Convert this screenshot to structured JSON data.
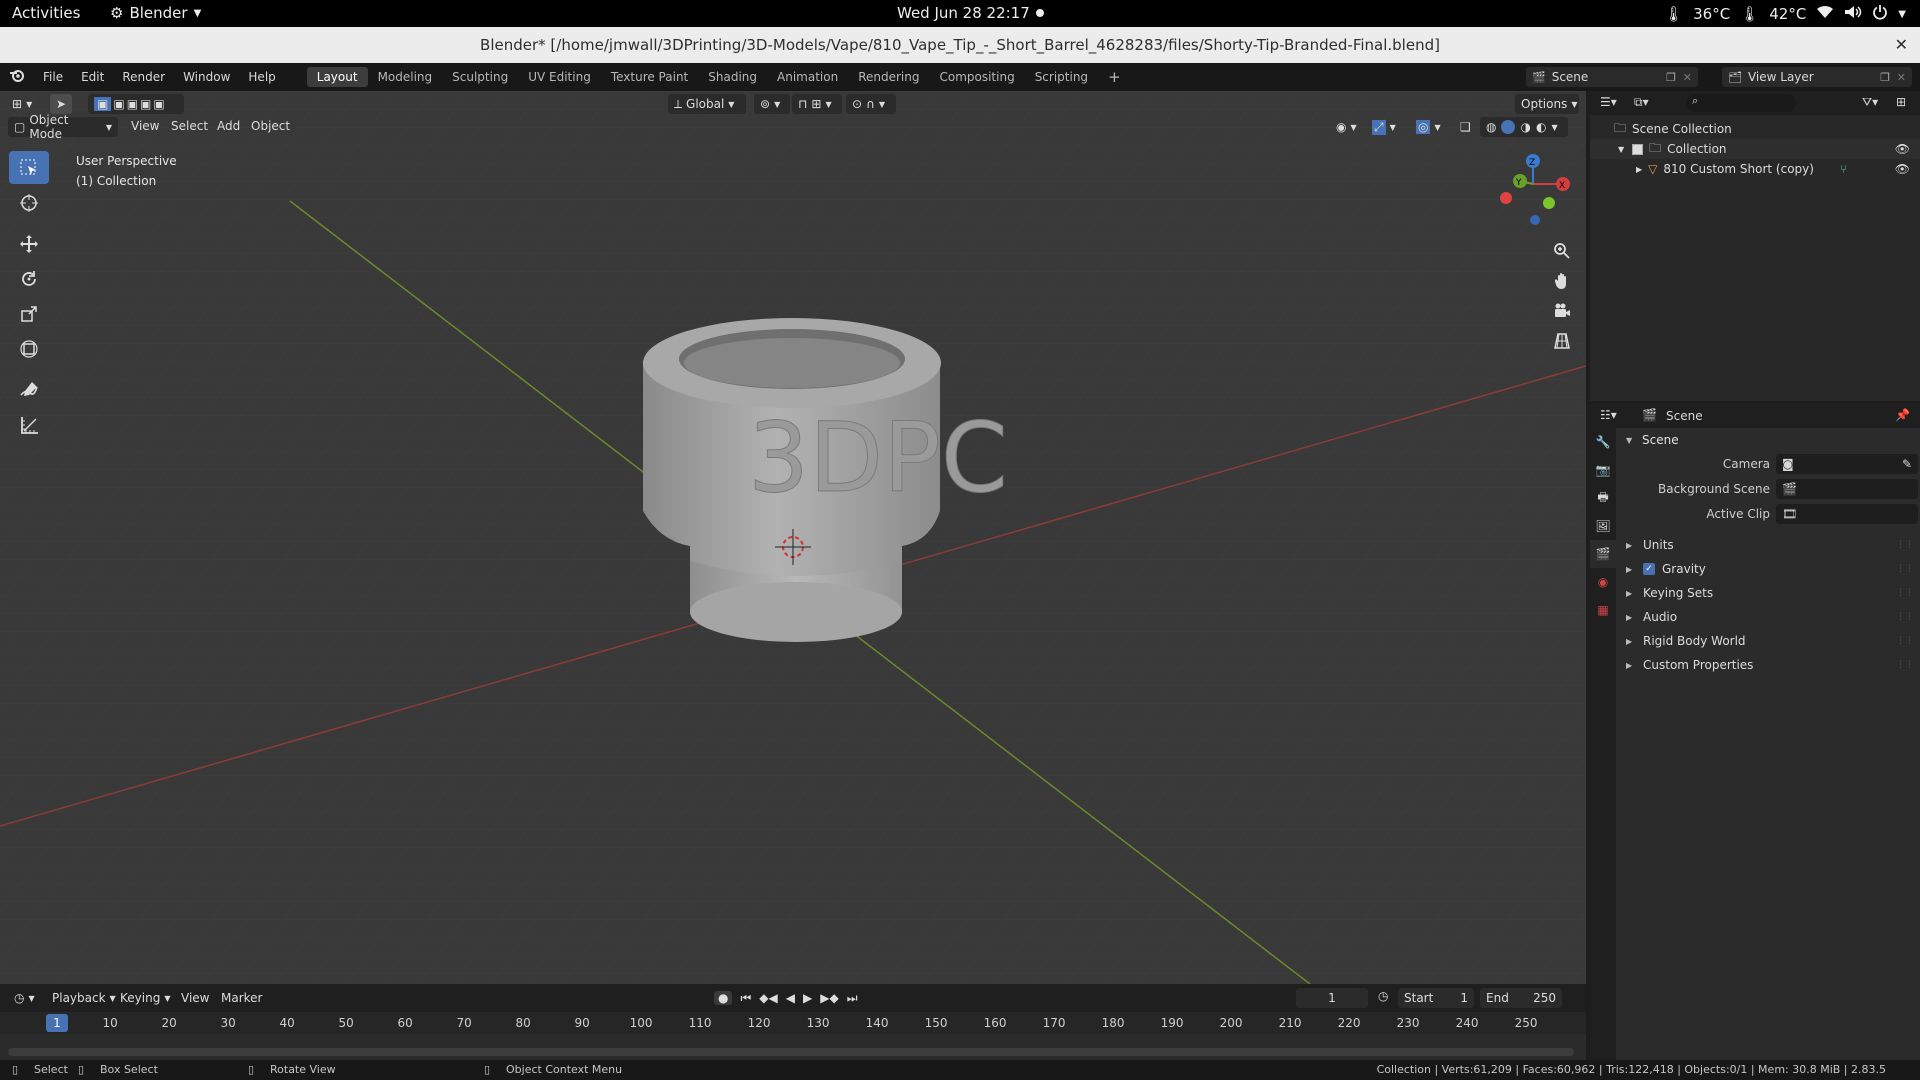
{
  "gnome": {
    "activities": "Activities",
    "app": "Blender",
    "clock": "Wed Jun 28  22:17",
    "temp1": "36°C",
    "temp2": "42°C"
  },
  "window": {
    "title": "Blender* [/home/jmwall/3DPrinting/3D-Models/Vape/810_Vape_Tip_-_Short_Barrel_4628283/files/Shorty-Tip-Branded-Final.blend]"
  },
  "menu": [
    "File",
    "Edit",
    "Render",
    "Window",
    "Help"
  ],
  "workspaces": [
    "Layout",
    "Modeling",
    "Sculpting",
    "UV Editing",
    "Texture Paint",
    "Shading",
    "Animation",
    "Rendering",
    "Compositing",
    "Scripting"
  ],
  "scene_selector": "Scene",
  "view_layer": "View Layer",
  "viewport": {
    "transform_orientation": "Global",
    "options": "Options",
    "mode": "Object Mode",
    "menus": [
      "View",
      "Select",
      "Add",
      "Object"
    ],
    "perspective": "User Perspective",
    "collection_info": "(1) Collection",
    "model_text": "3DPC"
  },
  "outliner": {
    "scene_collection": "Scene Collection",
    "collection": "Collection",
    "object": "810 Custom Short (copy)"
  },
  "properties": {
    "header": "Scene",
    "panel": "Scene",
    "fields": [
      {
        "label": "Camera",
        "value": ""
      },
      {
        "label": "Background Scene",
        "value": ""
      },
      {
        "label": "Active Clip",
        "value": ""
      }
    ],
    "subpanels": [
      {
        "label": "Units",
        "checkbox": false
      },
      {
        "label": "Gravity",
        "checkbox": true
      },
      {
        "label": "Keying Sets",
        "checkbox": false
      },
      {
        "label": "Audio",
        "checkbox": false
      },
      {
        "label": "Rigid Body World",
        "checkbox": false
      },
      {
        "label": "Custom Properties",
        "checkbox": false
      }
    ]
  },
  "timeline": {
    "menus": [
      "Playback",
      "Keying",
      "View",
      "Marker"
    ],
    "current_frame": "1",
    "start_label": "Start",
    "start": "1",
    "end_label": "End",
    "end": "250",
    "ticks": [
      "1",
      "10",
      "20",
      "30",
      "40",
      "50",
      "60",
      "70",
      "80",
      "90",
      "100",
      "110",
      "120",
      "130",
      "140",
      "150",
      "160",
      "170",
      "180",
      "190",
      "200",
      "210",
      "220",
      "230",
      "240",
      "250"
    ]
  },
  "status": {
    "select": "Select",
    "box_select": "Box Select",
    "rotate_view": "Rotate View",
    "context_menu": "Object Context Menu",
    "stats": "Collection | Verts:61,209 | Faces:60,962 | Tris:122,418 | Objects:0/1 | Mem: 30.8 MiB | 2.83.5"
  }
}
